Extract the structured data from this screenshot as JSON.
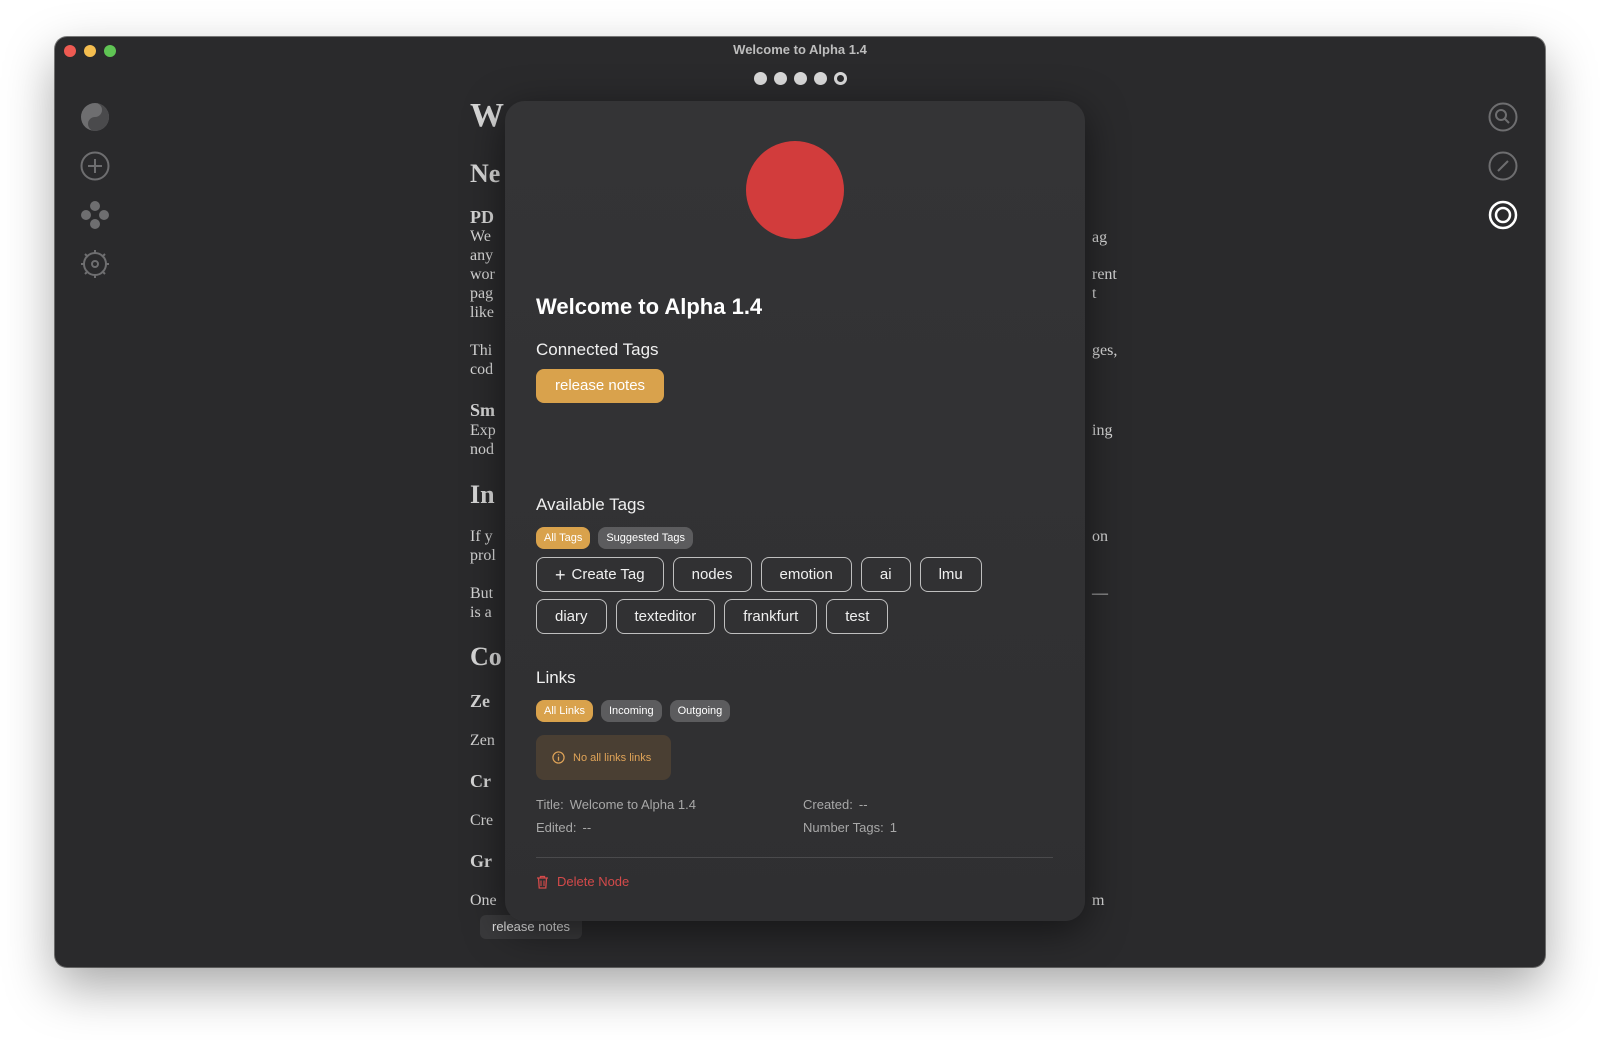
{
  "window": {
    "title": "Welcome to Alpha 1.4"
  },
  "pager": {
    "count": 5,
    "active_index": 4
  },
  "left_rail": [
    {
      "icon": "logo-icon"
    },
    {
      "icon": "add-icon"
    },
    {
      "icon": "nodes-icon"
    },
    {
      "icon": "settings-icon"
    }
  ],
  "right_rail": [
    {
      "icon": "search-icon"
    },
    {
      "icon": "edit-icon"
    },
    {
      "icon": "target-icon"
    }
  ],
  "document": {
    "left": [
      "W",
      "Ne",
      "PD",
      "We",
      "any",
      "wor",
      "pag",
      "like",
      "Thi",
      "cod",
      "Sm",
      "Exp",
      "nod",
      "In",
      "If y",
      "prol",
      "But",
      "is a",
      "Co",
      "Ze",
      "Zen",
      "Cr",
      "Cre",
      "Gr",
      "One"
    ],
    "right": [
      "ag",
      "rent",
      "t",
      "ges,",
      "ing",
      "on",
      "—",
      "m"
    ]
  },
  "bottom_tag": "release notes",
  "panel": {
    "node_color": "#d23c3c",
    "title": "Welcome to Alpha 1.4",
    "connected_tags_heading": "Connected Tags",
    "connected_tags": [
      "release notes"
    ],
    "available_tags_heading": "Available Tags",
    "tag_filters": [
      "All Tags",
      "Suggested Tags"
    ],
    "create_tag_label": "Create Tag",
    "tags_row1": [
      "nodes",
      "emotion",
      "ai",
      "lmu"
    ],
    "tags_row2": [
      "diary",
      "texteditor",
      "frankfurt",
      "test"
    ],
    "links_heading": "Links",
    "link_filters": [
      "All Links",
      "Incoming",
      "Outgoing"
    ],
    "no_links_message": "No all links links",
    "meta": {
      "title_label": "Title:",
      "title_value": "Welcome to Alpha 1.4",
      "created_label": "Created:",
      "created_value": "--",
      "edited_label": "Edited:",
      "edited_value": "--",
      "number_tags_label": "Number Tags:",
      "number_tags_value": "1"
    },
    "delete_label": "Delete Node"
  },
  "colors": {
    "accent": "#d9a24c",
    "danger": "#d34a4a",
    "background": "#2a2a2c"
  }
}
